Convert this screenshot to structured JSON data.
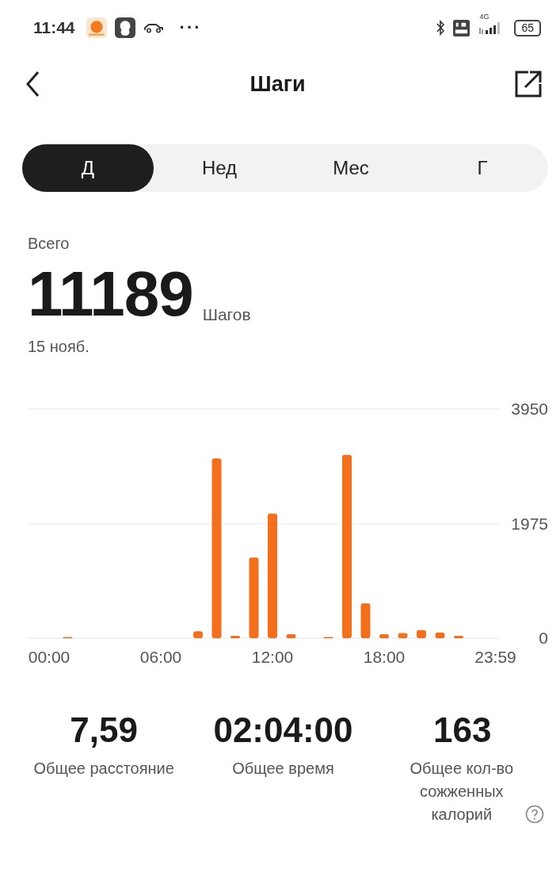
{
  "status_bar": {
    "time": "11:44",
    "more": "···",
    "network": "4G",
    "battery": "65"
  },
  "header": {
    "title": "Шаги"
  },
  "tabs": [
    {
      "label": "Д",
      "selected": true
    },
    {
      "label": "Нед",
      "selected": false
    },
    {
      "label": "Мес",
      "selected": false
    },
    {
      "label": "Г",
      "selected": false
    }
  ],
  "summary": {
    "label": "Всего",
    "value": "11189",
    "unit": "Шагов",
    "date": "15 нояб."
  },
  "chart_data": {
    "type": "bar",
    "x": [
      1,
      8,
      9,
      10,
      11,
      12,
      13,
      15,
      16,
      17,
      18,
      19,
      20,
      21,
      22
    ],
    "values": [
      20,
      120,
      3100,
      40,
      1390,
      2150,
      70,
      20,
      3160,
      600,
      70,
      90,
      140,
      100,
      40
    ],
    "xlim": [
      -1.15,
      24.17
    ],
    "ylim": [
      0,
      3950
    ],
    "yticks": [
      0,
      1975,
      3950
    ],
    "xticks": [
      {
        "value": 0,
        "label": "00:00"
      },
      {
        "value": 6,
        "label": "06:00"
      },
      {
        "value": 12,
        "label": "12:00"
      },
      {
        "value": 18,
        "label": "18:00"
      },
      {
        "value": 23.98,
        "label": "23:59"
      }
    ],
    "color": "#f36f1c"
  },
  "stats": [
    {
      "value": "7,59",
      "label": "Общее расстояние",
      "info": false
    },
    {
      "value": "02:04:00",
      "label": "Общее время",
      "info": false
    },
    {
      "value": "163",
      "label": "Общее кол-во сожженных калорий",
      "info": true
    }
  ]
}
